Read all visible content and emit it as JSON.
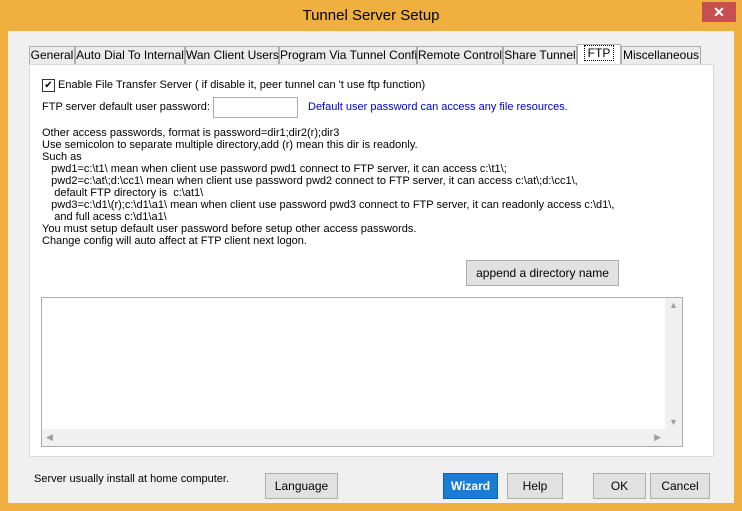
{
  "window": {
    "title": "Tunnel Server Setup",
    "close_glyph": "✕"
  },
  "tabs": [
    {
      "label": "General"
    },
    {
      "label": "Auto Dial To Internal"
    },
    {
      "label": "Wan Client Users"
    },
    {
      "label": "Program Via Tunnel Config"
    },
    {
      "label": "Remote Control"
    },
    {
      "label": "Share Tunnel"
    },
    {
      "label": "FTP"
    },
    {
      "label": "Miscellaneous"
    }
  ],
  "ftp": {
    "enable_label": "Enable File Transfer Server ( if disable it, peer tunnel can 't use ftp function)",
    "enable_checked": true,
    "default_password_label": "FTP server default user password:",
    "default_password_value": "",
    "default_password_hint": "Default user password can access any file resources.",
    "info_lines": [
      "Other access passwords, format is password=dir1;dir2(r);dir3",
      "Use semicolon to separate multiple directory,add (r) mean this dir is readonly.",
      "Such as",
      "   pwd1=c:\\t1\\ mean when client use password pwd1 connect to FTP server, it can access c:\\t1\\;",
      "   pwd2=c:\\at\\;d:\\cc1\\ mean when client use password pwd2 connect to FTP server, it can access c:\\at\\;d:\\cc1\\,",
      "    default FTP directory is  c:\\at1\\",
      "   pwd3=c:\\d1\\(r);c:\\d1\\a1\\ mean when client use password pwd3 connect to FTP server, it can readonly access c:\\d1\\,",
      "    and full acess c:\\d1\\a1\\",
      "You must setup default user password before setup other access passwords.",
      "Change config will auto affect at FTP client next logon."
    ],
    "append_button": "append a directory name",
    "passwords_text": ""
  },
  "footer": {
    "status": "Server usually install at home computer.",
    "language": "Language",
    "wizard": "Wizard",
    "help": "Help",
    "ok": "OK",
    "cancel": "Cancel"
  }
}
